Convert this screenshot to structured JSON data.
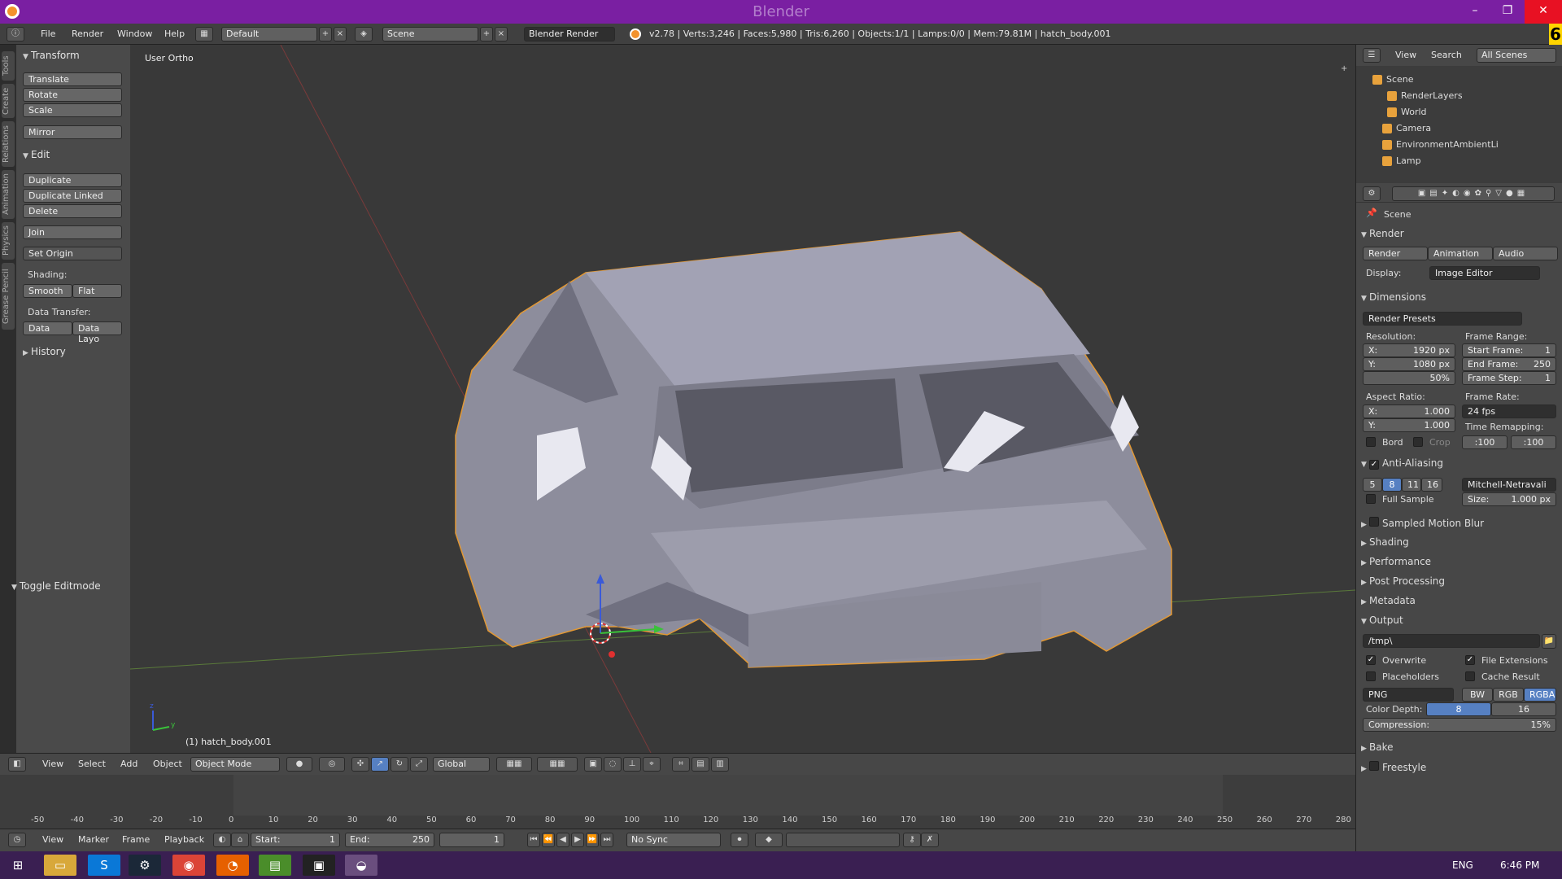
{
  "window": {
    "title": "Blender",
    "logo": "blender-logo",
    "min": "–",
    "max": "❐",
    "close": "✕"
  },
  "info": {
    "menus": [
      "File",
      "Render",
      "Window",
      "Help"
    ],
    "layout": "Default",
    "scene": "Scene",
    "engine": "Blender Render",
    "stats": "v2.78 | Verts:3,246 | Faces:5,980 | Tris:6,260 | Objects:1/1 | Lamps:0/0 | Mem:79.81M | hatch_body.001",
    "badge": "6"
  },
  "lefttabs": [
    "Tools",
    "Create",
    "Relations",
    "Animation",
    "Physics",
    "Grease Pencil"
  ],
  "toolshelf": {
    "transform": {
      "title": "Transform",
      "buttons": [
        "Translate",
        "Rotate",
        "Scale",
        "Mirror"
      ]
    },
    "edit": {
      "title": "Edit",
      "buttons": [
        "Duplicate",
        "Duplicate Linked",
        "Delete",
        "Join"
      ],
      "set_origin": "Set Origin",
      "shading_label": "Shading:",
      "smooth": "Smooth",
      "flat": "Flat",
      "data_transfer_label": "Data Transfer:",
      "data": "Data",
      "data_layout": "Data Layo"
    },
    "history": "History",
    "toggle_editmode": "Toggle Editmode"
  },
  "viewport": {
    "view_label": "User Ortho",
    "object_label": "(1) hatch_body.001",
    "axis_x": "x",
    "axis_y": "y",
    "axis_z": "z"
  },
  "vp3d_header": {
    "menus": [
      "View",
      "Select",
      "Add",
      "Object"
    ],
    "mode": "Object Mode",
    "orientation": "Global"
  },
  "timeline": {
    "ticks": [
      "-50",
      "-40",
      "-30",
      "-20",
      "-10",
      "0",
      "10",
      "20",
      "30",
      "40",
      "50",
      "60",
      "70",
      "80",
      "90",
      "100",
      "110",
      "120",
      "130",
      "140",
      "150",
      "160",
      "170",
      "180",
      "190",
      "200",
      "210",
      "220",
      "230",
      "240",
      "250",
      "260",
      "270",
      "280"
    ],
    "current_frame_tick": "0"
  },
  "timeline_header": {
    "menus": [
      "View",
      "Marker",
      "Frame",
      "Playback"
    ],
    "start_label": "Start:",
    "start": "1",
    "end_label": "End:",
    "end": "250",
    "current": "1",
    "sync": "No Sync"
  },
  "outliner": {
    "menus": [
      "View",
      "Search"
    ],
    "filter": "All Scenes",
    "items": [
      {
        "label": "Scene",
        "icon": "scene-icon"
      },
      {
        "label": "RenderLayers",
        "icon": "renderlayers-icon"
      },
      {
        "label": "World",
        "icon": "world-icon"
      },
      {
        "label": "Camera",
        "icon": "camera-icon"
      },
      {
        "label": "EnvironmentAmbientLi",
        "icon": "light-icon"
      },
      {
        "label": "Lamp",
        "icon": "lamp-icon"
      }
    ]
  },
  "properties": {
    "context": "Scene",
    "render": {
      "title": "Render",
      "render_btn": "Render",
      "animation_btn": "Animation",
      "audio_btn": "Audio",
      "display_label": "Display:",
      "display": "Image Editor"
    },
    "dimensions": {
      "title": "Dimensions",
      "presets": "Render Presets",
      "resolution_label": "Resolution:",
      "res_x": "X:",
      "res_x_val": "1920 px",
      "res_y": "Y:",
      "res_y_val": "1080 px",
      "percent": "50%",
      "frame_range_label": "Frame Range:",
      "start_frame": "Start Frame:",
      "start_frame_val": "1",
      "end_frame": "End Frame:",
      "end_frame_val": "250",
      "frame_step": "Frame Step:",
      "frame_step_val": "1",
      "aspect_label": "Aspect Ratio:",
      "asp_x": "X:",
      "asp_x_val": "1.000",
      "asp_y": "Y:",
      "asp_y_val": "1.000",
      "frame_rate_label": "Frame Rate:",
      "frame_rate": "24 fps",
      "time_remap_label": "Time Remapping:",
      "remap_old": ":100",
      "remap_new": ":100",
      "bord": "Bord",
      "crop": "Crop"
    },
    "aa": {
      "title": "Anti-Aliasing",
      "samples": [
        "5",
        "8",
        "11",
        "16"
      ],
      "selected": "8",
      "filter": "Mitchell-Netravali",
      "full_sample": "Full Sample",
      "size_label": "Size:",
      "size": "1.000 px"
    },
    "collapsed": [
      "Sampled Motion Blur",
      "Shading",
      "Performance",
      "Post Processing",
      "Metadata"
    ],
    "output": {
      "title": "Output",
      "path": "/tmp\\",
      "overwrite": "Overwrite",
      "file_ext": "File Extensions",
      "placeholders": "Placeholders",
      "cache": "Cache Result",
      "format": "PNG",
      "bw": "BW",
      "rgb": "RGB",
      "rgba": "RGBA",
      "depth_label": "Color Depth:",
      "depth8": "8",
      "depth16": "16",
      "compression_label": "Compression:",
      "compression": "15%"
    },
    "bake": "Bake",
    "freestyle": "Freestyle"
  },
  "taskbar": {
    "lang": "ENG",
    "time": "6:46 PM"
  }
}
